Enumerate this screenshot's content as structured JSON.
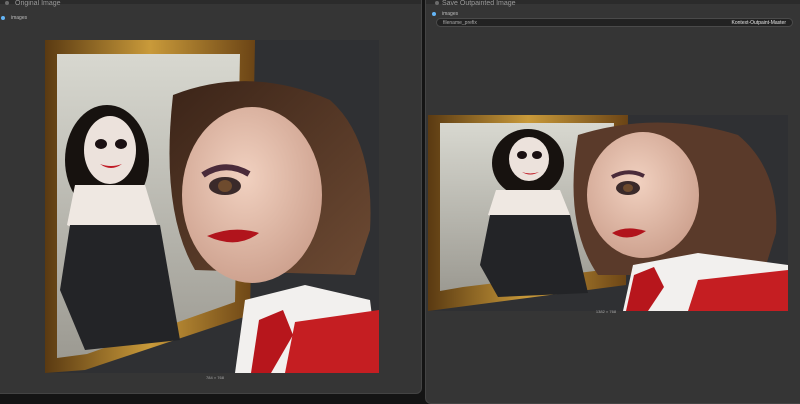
{
  "nodes": {
    "original": {
      "title": "Original Image",
      "output_label": "images",
      "image_dims": "784 × 768"
    },
    "saved": {
      "title": "Save Outpainted Image",
      "input_label": "images",
      "widget": {
        "name": "filename_prefix",
        "value": "Kontext-Outpaint-Master"
      },
      "image_dims": "1382 × 768"
    }
  },
  "colors": {
    "canvas_bg": "#141414",
    "node_bg": "#353535",
    "port_image": "#64b5f6"
  },
  "icons": [
    "node-status-dot-icon",
    "port-dot-icon"
  ]
}
